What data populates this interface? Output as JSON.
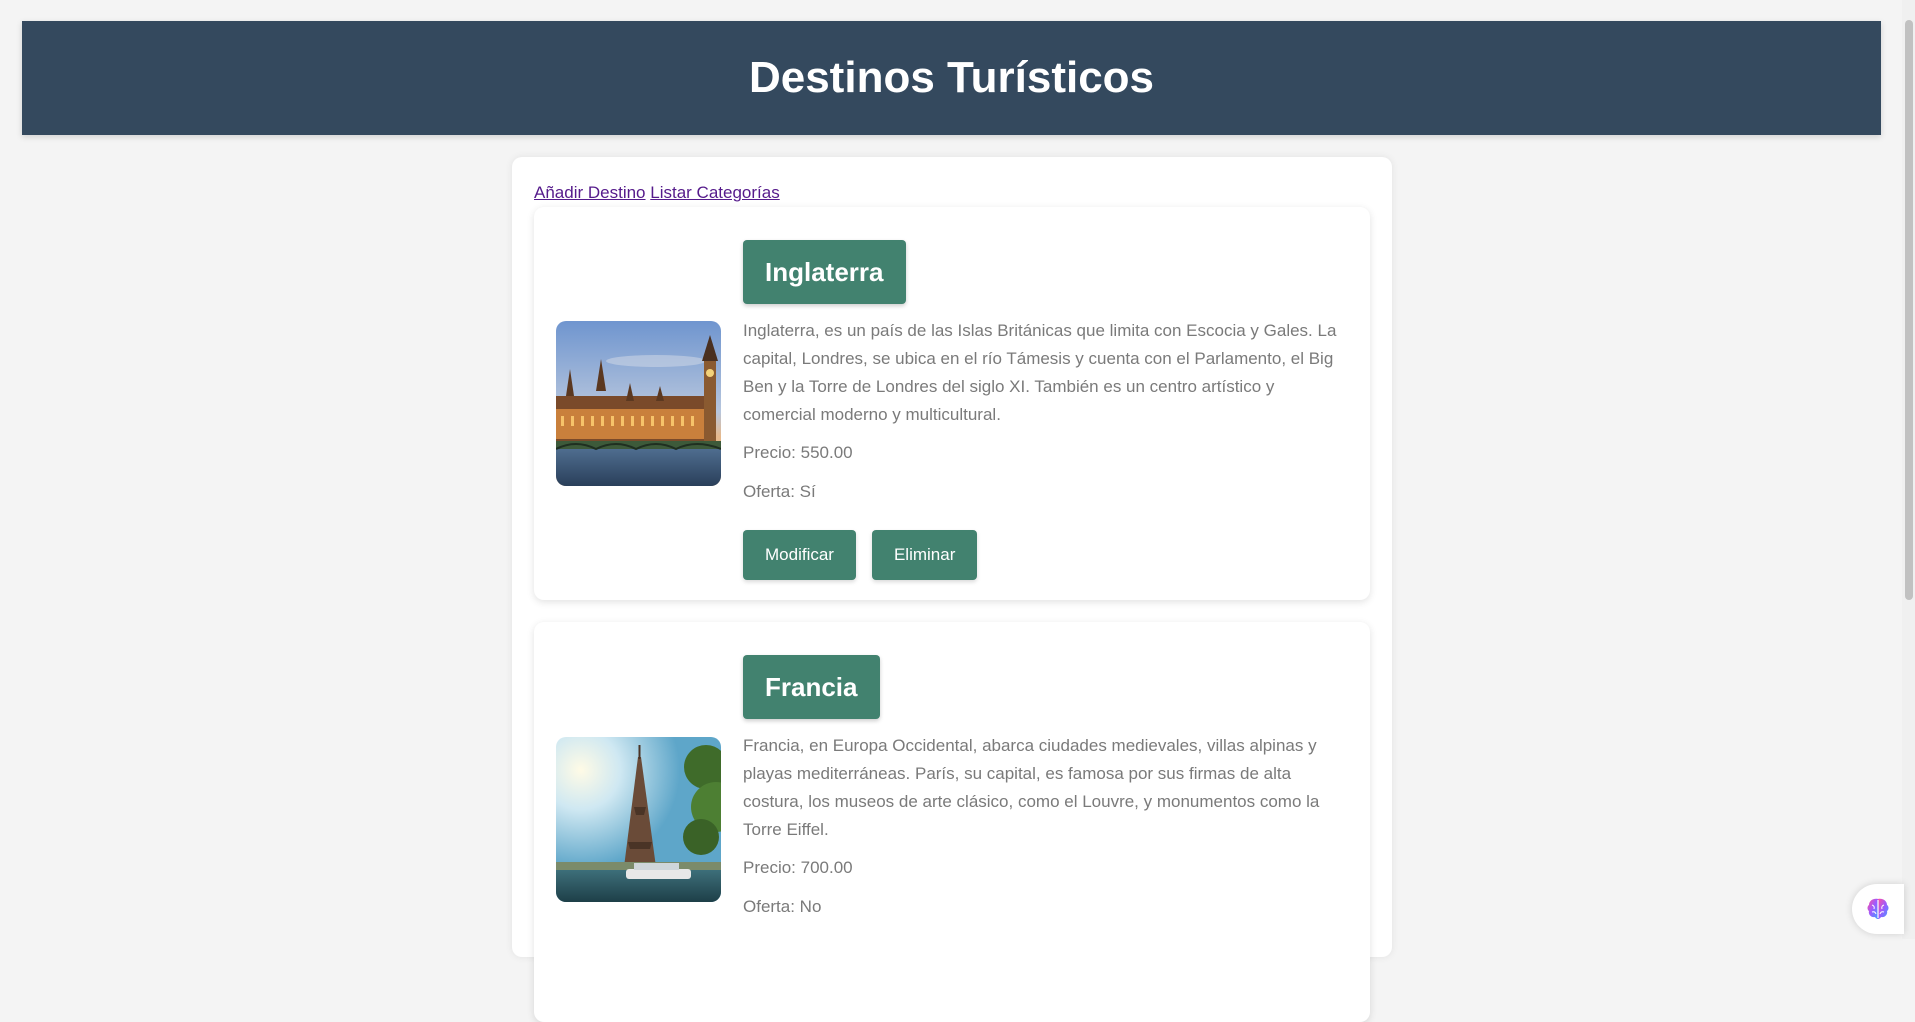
{
  "header": {
    "title": "Destinos Turísticos"
  },
  "nav": {
    "add_label": "Añadir Destino",
    "list_label": "Listar Categorías"
  },
  "destinations": [
    {
      "name": "Inglaterra",
      "description": "Inglaterra, es un país de las Islas Británicas que limita con Escocia y Gales. La capital, Londres, se ubica en el río Támesis y cuenta con el Parlamento, el Big Ben y la Torre de Londres del siglo XI. También es un centro artístico y comercial moderno y multicultural.",
      "price": "Precio: 550.00",
      "offer": "Oferta: Sí",
      "image": "london-parliament-photo",
      "modify_label": "Modificar",
      "delete_label": "Eliminar"
    },
    {
      "name": "Francia",
      "description": "Francia, en Europa Occidental, abarca ciudades medievales, villas alpinas y playas mediterráneas. París, su capital, es famosa por sus firmas de alta costura, los museos de arte clásico, como el Louvre, y monumentos como la Torre Eiffel.",
      "price": "Precio: 700.00",
      "offer": "Oferta: No",
      "image": "eiffel-tower-photo"
    }
  ],
  "colors": {
    "header_bg": "#34495e",
    "accent": "#42826f",
    "page_bg": "#f4f4f4",
    "link": "#551a8b"
  },
  "widget": {
    "icon": "brain-icon"
  }
}
